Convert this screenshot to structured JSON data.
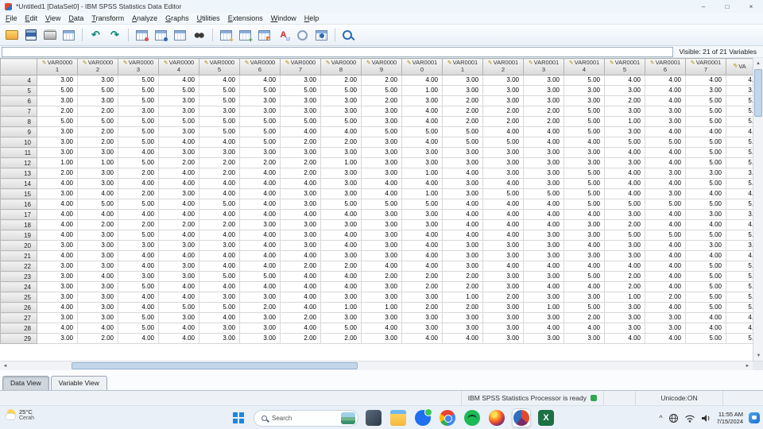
{
  "window": {
    "title": "*Untitled1 [DataSet0] - IBM SPSS Statistics Data Editor",
    "controls": {
      "minimize": "–",
      "maximize": "□",
      "close": "×"
    }
  },
  "menu": {
    "items": [
      "File",
      "Edit",
      "View",
      "Data",
      "Transform",
      "Analyze",
      "Graphs",
      "Utilities",
      "Extensions",
      "Window",
      "Help"
    ]
  },
  "toolbar": {
    "icons": [
      "open-file",
      "save",
      "print",
      "recall-dialogs",
      "sep",
      "undo",
      "redo",
      "sep",
      "goto-case",
      "goto-variable",
      "variables",
      "find",
      "sep",
      "insert-cases",
      "insert-variable",
      "split-file",
      "value-labels",
      "use-sets",
      "select-cases",
      "sep",
      "zoom"
    ]
  },
  "editor_bar": {
    "value": "",
    "visible_label": "Visible: 21 of 21 Variables"
  },
  "grid": {
    "columns": [
      {
        "t": "VAR0000",
        "b": "1"
      },
      {
        "t": "VAR0000",
        "b": "2"
      },
      {
        "t": "VAR0000",
        "b": "3"
      },
      {
        "t": "VAR0000",
        "b": "4"
      },
      {
        "t": "VAR0000",
        "b": "5"
      },
      {
        "t": "VAR0000",
        "b": "6"
      },
      {
        "t": "VAR0000",
        "b": "7"
      },
      {
        "t": "VAR0000",
        "b": "8"
      },
      {
        "t": "VAR0000",
        "b": "9"
      },
      {
        "t": "VAR0001",
        "b": "0"
      },
      {
        "t": "VAR0001",
        "b": "1"
      },
      {
        "t": "VAR0001",
        "b": "2"
      },
      {
        "t": "VAR0001",
        "b": "3"
      },
      {
        "t": "VAR0001",
        "b": "4"
      },
      {
        "t": "VAR0001",
        "b": "5"
      },
      {
        "t": "VAR0001",
        "b": "6"
      },
      {
        "t": "VAR0001",
        "b": "7"
      },
      {
        "t": "VA",
        "b": ""
      }
    ],
    "rows": [
      {
        "n": 4,
        "v": [
          3,
          3,
          5,
          4,
          4,
          4,
          3,
          2,
          2,
          4,
          3,
          3,
          3,
          5,
          4,
          4,
          4,
          4
        ]
      },
      {
        "n": 5,
        "v": [
          5,
          5,
          5,
          5,
          5,
          5,
          5,
          5,
          5,
          1,
          3,
          3,
          3,
          3,
          3,
          4,
          3,
          3
        ]
      },
      {
        "n": 6,
        "v": [
          3,
          3,
          5,
          3,
          5,
          3,
          3,
          3,
          2,
          3,
          2,
          3,
          3,
          3,
          2,
          4,
          5,
          5
        ]
      },
      {
        "n": 7,
        "v": [
          2,
          2,
          3,
          3,
          3,
          3,
          3,
          3,
          3,
          4,
          2,
          2,
          2,
          5,
          3,
          3,
          5,
          5
        ]
      },
      {
        "n": 8,
        "v": [
          5,
          5,
          5,
          5,
          5,
          5,
          5,
          5,
          3,
          4,
          2,
          2,
          2,
          5,
          1,
          3,
          5,
          5
        ]
      },
      {
        "n": 9,
        "v": [
          3,
          2,
          5,
          3,
          5,
          5,
          4,
          4,
          5,
          5,
          5,
          4,
          4,
          5,
          3,
          4,
          4,
          4
        ]
      },
      {
        "n": 10,
        "v": [
          3,
          2,
          5,
          4,
          4,
          5,
          2,
          2,
          3,
          4,
          5,
          5,
          4,
          4,
          5,
          5,
          5,
          5
        ]
      },
      {
        "n": 11,
        "v": [
          3,
          3,
          4,
          3,
          3,
          3,
          3,
          3,
          3,
          3,
          3,
          3,
          3,
          3,
          4,
          4,
          5,
          5
        ]
      },
      {
        "n": 12,
        "v": [
          1,
          1,
          5,
          2,
          2,
          2,
          2,
          1,
          3,
          3,
          3,
          3,
          3,
          3,
          3,
          4,
          5,
          5
        ]
      },
      {
        "n": 13,
        "v": [
          2,
          3,
          2,
          4,
          2,
          4,
          2,
          3,
          3,
          1,
          4,
          3,
          3,
          5,
          4,
          3,
          3,
          3
        ]
      },
      {
        "n": 14,
        "v": [
          4,
          3,
          4,
          4,
          4,
          4,
          4,
          3,
          4,
          4,
          3,
          4,
          3,
          5,
          4,
          4,
          5,
          5
        ]
      },
      {
        "n": 15,
        "v": [
          3,
          4,
          2,
          3,
          4,
          4,
          3,
          3,
          4,
          1,
          3,
          5,
          5,
          5,
          4,
          3,
          4,
          4
        ]
      },
      {
        "n": 16,
        "v": [
          4,
          5,
          5,
          4,
          5,
          4,
          3,
          5,
          5,
          5,
          4,
          4,
          4,
          5,
          5,
          5,
          5,
          5
        ]
      },
      {
        "n": 17,
        "v": [
          4,
          4,
          4,
          4,
          4,
          4,
          4,
          4,
          3,
          3,
          4,
          4,
          4,
          4,
          3,
          4,
          3,
          3
        ]
      },
      {
        "n": 18,
        "v": [
          4,
          2,
          2,
          2,
          2,
          3,
          3,
          3,
          3,
          3,
          4,
          4,
          4,
          3,
          2,
          4,
          4,
          4
        ]
      },
      {
        "n": 19,
        "v": [
          4,
          3,
          5,
          4,
          4,
          4,
          3,
          4,
          3,
          4,
          4,
          4,
          3,
          3,
          5,
          5,
          5,
          5
        ]
      },
      {
        "n": 20,
        "v": [
          3,
          3,
          3,
          3,
          3,
          4,
          3,
          4,
          3,
          4,
          3,
          3,
          3,
          4,
          3,
          4,
          3,
          3
        ]
      },
      {
        "n": 21,
        "v": [
          4,
          3,
          4,
          4,
          4,
          4,
          4,
          3,
          3,
          4,
          3,
          3,
          3,
          3,
          3,
          4,
          4,
          4
        ]
      },
      {
        "n": 22,
        "v": [
          3,
          3,
          4,
          3,
          4,
          4,
          2,
          2,
          4,
          4,
          3,
          4,
          4,
          4,
          4,
          4,
          5,
          5
        ]
      },
      {
        "n": 23,
        "v": [
          3,
          4,
          3,
          3,
          5,
          5,
          4,
          4,
          2,
          2,
          2,
          3,
          3,
          5,
          2,
          4,
          5,
          5
        ]
      },
      {
        "n": 24,
        "v": [
          3,
          3,
          5,
          4,
          4,
          4,
          4,
          4,
          3,
          2,
          2,
          3,
          4,
          4,
          2,
          4,
          5,
          5
        ]
      },
      {
        "n": 25,
        "v": [
          3,
          3,
          4,
          4,
          3,
          3,
          4,
          3,
          3,
          3,
          1,
          2,
          3,
          3,
          1,
          2,
          5,
          5
        ]
      },
      {
        "n": 26,
        "v": [
          4,
          3,
          4,
          5,
          5,
          2,
          4,
          1,
          1,
          2,
          2,
          3,
          1,
          5,
          3,
          4,
          5,
          5
        ]
      },
      {
        "n": 27,
        "v": [
          3,
          3,
          5,
          3,
          4,
          3,
          2,
          3,
          3,
          3,
          3,
          3,
          3,
          2,
          3,
          3,
          4,
          4
        ]
      },
      {
        "n": 28,
        "v": [
          4,
          4,
          5,
          4,
          3,
          3,
          4,
          5,
          4,
          3,
          3,
          3,
          4,
          4,
          3,
          3,
          4,
          4
        ]
      },
      {
        "n": 29,
        "v": [
          3,
          2,
          4,
          4,
          3,
          3,
          2,
          2,
          3,
          4,
          4,
          3,
          3,
          3,
          4,
          4,
          5,
          5
        ]
      }
    ]
  },
  "tabs": [
    {
      "label": "Data View",
      "active": true
    },
    {
      "label": "Variable View",
      "active": false
    }
  ],
  "status_bar": {
    "message": "IBM SPSS Statistics Processor is ready",
    "unicode_label": "Unicode:ON"
  },
  "taskbar": {
    "weather_temp": "25°C",
    "weather_desc": "Cerah",
    "search_label": "Search",
    "app_icons": [
      "task-view",
      "file-explorer",
      "messages",
      "chrome",
      "spotify",
      "firefox",
      "spss",
      "excel"
    ],
    "active_app": "spss",
    "tray_icons": [
      "hidden-icons-chevron",
      "globe",
      "wifi",
      "volume"
    ],
    "time": "11:55 AM",
    "date": "7/15/2024"
  }
}
